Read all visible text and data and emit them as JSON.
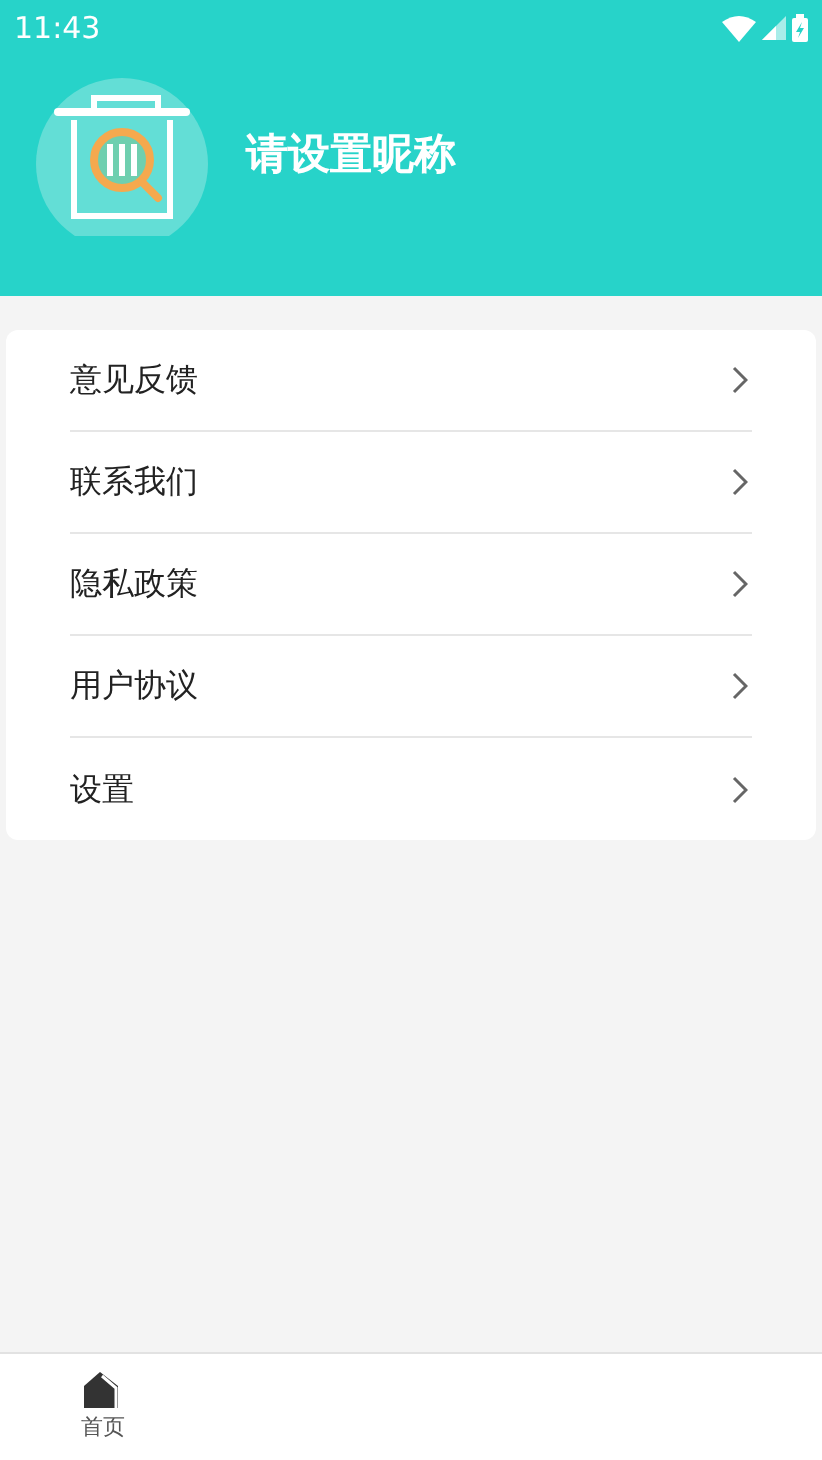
{
  "status_bar": {
    "time": "11:43"
  },
  "profile": {
    "nickname": "请设置昵称"
  },
  "menu": [
    {
      "label": "意见反馈"
    },
    {
      "label": "联系我们"
    },
    {
      "label": "隐私政策"
    },
    {
      "label": "用户协议"
    },
    {
      "label": "设置"
    }
  ],
  "bottom_nav": [
    {
      "label": "首页",
      "selected": false
    }
  ]
}
